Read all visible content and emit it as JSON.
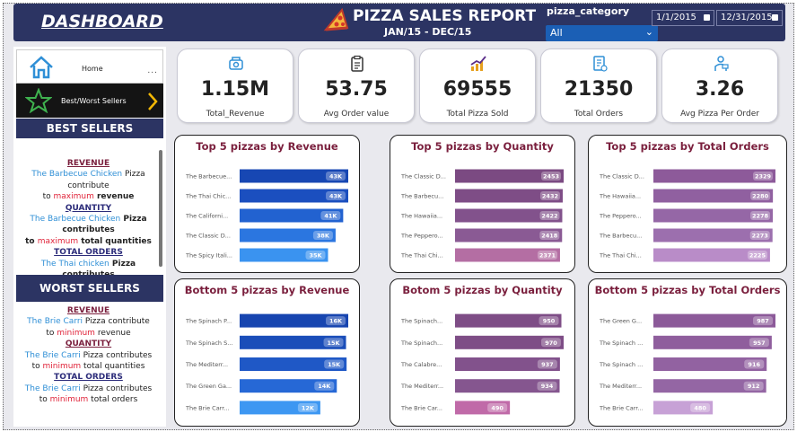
{
  "header": {
    "dashboard_title": "DASHBOARD",
    "report_title": "PIZZA SALES REPORT",
    "report_subtitle": "JAN/15 - DEC/15",
    "slicer_label": "pizza_category",
    "slicer_value": "All",
    "date_start": "1/1/2015",
    "date_end": "12/31/2015"
  },
  "sidebar": {
    "home_label": "Home",
    "more_label": "...",
    "nav_label": "Best/Worst Sellers",
    "best_title": "BEST SELLERS",
    "worst_title": "WORST SELLERS",
    "best": {
      "rev_head": "REVENUE",
      "rev_item": "The Barbecue Chicken",
      "rev_t1": " Pizza",
      "rev_t2": "contribute",
      "rev_t3": "to ",
      "rev_max": "maximum",
      "rev_t4": " revenue",
      "qty_head": "QUANTITY",
      "qty_item": "The Barbecue Chicken",
      "qty_t1": " Pizza",
      "qty_t2": "contributes",
      "qty_t3": "to ",
      "qty_max": "maximum",
      "qty_t4": " total quantities",
      "ord_head": "TOTAL ORDERS",
      "ord_item": "The Thai  chicken",
      "ord_t1": " Pizza contributes"
    },
    "worst": {
      "rev_head": "REVENUE",
      "rev_item": "The Brie  Carri",
      "rev_t1": " Pizza contribute",
      "rev_t2": "to ",
      "rev_min": "minimum",
      "rev_t3": " revenue",
      "qty_head": "QUANTITY",
      "qty_item": "The Brie  Carri",
      "qty_t1": " Pizza contributes",
      "qty_t2": "to ",
      "qty_min": "minimum",
      "qty_t3": " total quantities",
      "ord_head": "TOTAL ORDERS",
      "ord_item": "The Brie  Carri",
      "ord_t1": " Pizza contributes",
      "ord_t2": "to ",
      "ord_min": "minimum",
      "ord_t3": " total orders"
    }
  },
  "kpis": [
    {
      "value": "1.15M",
      "label": "Total_Revenue",
      "icon": "money-icon"
    },
    {
      "value": "53.75",
      "label": "Avg Order value",
      "icon": "clipboard-icon"
    },
    {
      "value": "69555",
      "label": "Total Pizza Sold",
      "icon": "growth-chart-icon"
    },
    {
      "value": "21350",
      "label": "Total Orders",
      "icon": "order-list-icon"
    },
    {
      "value": "3.26",
      "label": "Avg Pizza Per Order",
      "icon": "delivery-icon"
    }
  ],
  "chart_data": [
    {
      "type": "bar",
      "orientation": "horizontal",
      "title": "Top 5 pizzas by Revenue",
      "categories": [
        "The Barbecue Chicken Pizza",
        "The Thai Chicken Pizza",
        "The California Chicken Pizza",
        "The Classic Deluxe Pizza",
        "The Spicy Italian Pizza"
      ],
      "tick_labels": [
        "The Barbecue...",
        "The Thai Chic...",
        "The Californi...",
        "The Classic D...",
        "The Spicy Itali..."
      ],
      "values": [
        43000,
        43000,
        41000,
        38000,
        35000
      ],
      "data_labels": [
        "43K",
        "43K",
        "41K",
        "38K",
        "35K"
      ],
      "colors": [
        "#1747b3",
        "#1b4fbf",
        "#2262d0",
        "#2b76e0",
        "#3a93f0"
      ]
    },
    {
      "type": "bar",
      "orientation": "horizontal",
      "title": "Top 5 pizzas by Quantity",
      "categories": [
        "The Classic Deluxe Pizza",
        "The Barbecue Chicken Pizza",
        "The Hawaiian Pizza",
        "The Pepperoni Pizza",
        "The Thai Chicken Pizza"
      ],
      "tick_labels": [
        "The Classic D...",
        "The Barbecu...",
        "The Hawaiia...",
        "The Peppero...",
        "The Thai Chi..."
      ],
      "values": [
        2453,
        2432,
        2422,
        2418,
        2371
      ],
      "data_labels": [
        "2453",
        "2432",
        "2422",
        "2418",
        "2371"
      ],
      "colors": [
        "#7b4a82",
        "#7e4d86",
        "#82528c",
        "#8a5a94",
        "#b46ea3"
      ]
    },
    {
      "type": "bar",
      "orientation": "horizontal",
      "title": "Top 5 pizzas by Total Orders",
      "categories": [
        "The Classic Deluxe Pizza",
        "The Hawaiian Pizza",
        "The Pepperoni Pizza",
        "The Barbecue Chicken Pizza",
        "The Thai Chicken Pizza"
      ],
      "tick_labels": [
        "The Classic D...",
        "The Hawaiia...",
        "The Peppero...",
        "The Barbecu...",
        "The Thai Chi..."
      ],
      "values": [
        2329,
        2280,
        2278,
        2273,
        2225
      ],
      "data_labels": [
        "2329",
        "2280",
        "2278",
        "2273",
        "2225"
      ],
      "colors": [
        "#8d5a9a",
        "#9060a0",
        "#9567a6",
        "#9c6fae",
        "#b98cc8"
      ]
    },
    {
      "type": "bar",
      "orientation": "horizontal",
      "title": "Bottom 5 pizzas by Revenue",
      "categories": [
        "The Spinach Pesto Pizza",
        "The Spinach Supreme Pizza",
        "The Mediterranean Pizza",
        "The Green Garden Pizza",
        "The Brie Carre Pizza"
      ],
      "tick_labels": [
        "The Spinach P...",
        "The Spinach S...",
        "The Mediterr...",
        "The Green Ga...",
        "The Brie Carr..."
      ],
      "values": [
        15596,
        15278,
        15360,
        13956,
        11588
      ],
      "data_labels": [
        "16K",
        "15K",
        "15K",
        "14K",
        "12K"
      ],
      "colors": [
        "#1745b0",
        "#1a4db9",
        "#1f58c6",
        "#2668d6",
        "#3d97f2"
      ]
    },
    {
      "type": "bar",
      "orientation": "horizontal",
      "title": "Botom 5 pizzas by Quantity",
      "categories": [
        "The Spinach Supreme Pizza",
        "The Spinach Pesto Pizza",
        "The Calabrese Pizza",
        "The Mediterranean Pizza",
        "The Brie Carre Pizza"
      ],
      "tick_labels": [
        "The Spinach...",
        "The Spinach...",
        "The Calabre...",
        "The Mediterr...",
        "The Brie Car..."
      ],
      "values": [
        950,
        970,
        937,
        934,
        490
      ],
      "data_labels": [
        "950",
        "970",
        "937",
        "934",
        "490"
      ],
      "colors": [
        "#7e4d86",
        "#7e4d86",
        "#82528c",
        "#85568f",
        "#c06aa8"
      ]
    },
    {
      "type": "bar",
      "orientation": "horizontal",
      "title": "Bottom 5 pizzas by Total Orders",
      "categories": [
        "The Green Garden Pizza",
        "The Spinach Pesto Pizza",
        "The Spinach Supreme Pizza",
        "The Mediterranean Pizza",
        "The Brie Carre Pizza"
      ],
      "tick_labels": [
        "The Green G...",
        "The Spinach ...",
        "The Spinach ...",
        "The Mediterr...",
        "The Brie Carr..."
      ],
      "values": [
        987,
        957,
        916,
        912,
        480
      ],
      "data_labels": [
        "987",
        "957",
        "916",
        "912",
        "480"
      ],
      "colors": [
        "#8c5a99",
        "#8f5e9d",
        "#9262a1",
        "#9466a4",
        "#c7a1d6"
      ]
    }
  ]
}
